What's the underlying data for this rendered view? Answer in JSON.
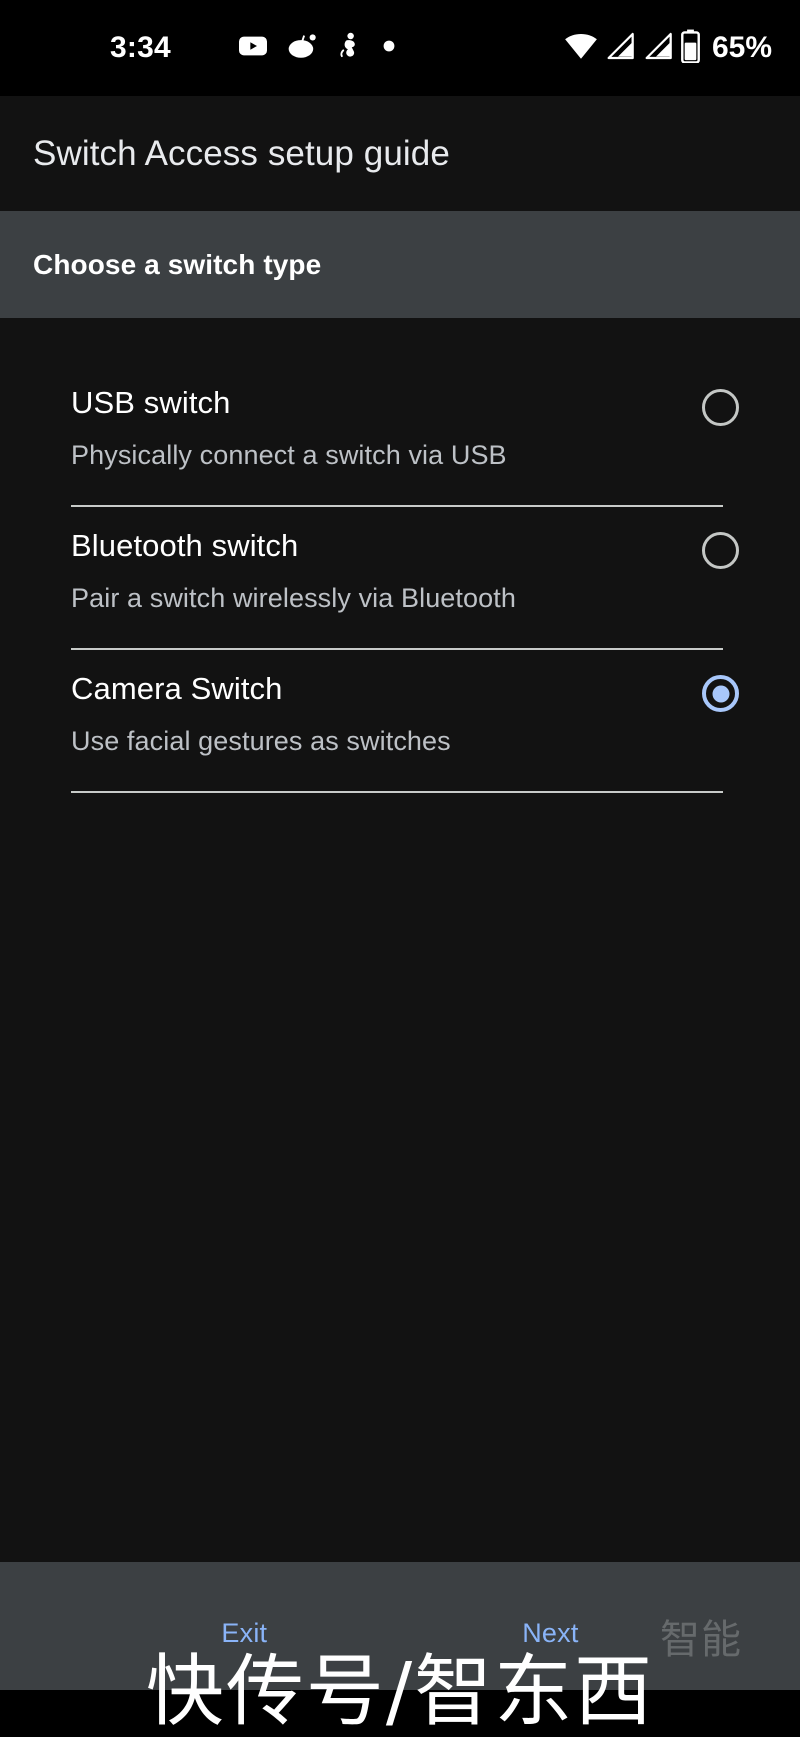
{
  "status_bar": {
    "time": "3:34",
    "battery_percent": "65%",
    "left_icons": [
      {
        "name": "telegram-icon"
      },
      {
        "name": "youtube-icon"
      },
      {
        "name": "reddit-icon"
      },
      {
        "name": "app-notification-icon"
      },
      {
        "name": "dot-notification-icon"
      }
    ],
    "right_icons": [
      {
        "name": "wifi-icon"
      },
      {
        "name": "cellular-signal-1-icon"
      },
      {
        "name": "cellular-signal-2-icon"
      },
      {
        "name": "battery-icon"
      }
    ]
  },
  "header": {
    "title": "Switch Access setup guide"
  },
  "section": {
    "heading": "Choose a switch type"
  },
  "options": [
    {
      "title": "USB switch",
      "description": "Physically connect a switch via USB",
      "selected": false
    },
    {
      "title": "Bluetooth switch",
      "description": "Pair a switch wirelessly via Bluetooth",
      "selected": false
    },
    {
      "title": "Camera Switch",
      "description": "Use facial gestures as switches",
      "selected": true
    }
  ],
  "bottom_bar": {
    "exit_label": "Exit",
    "next_label": "Next"
  },
  "watermark": {
    "text": "快传号/智东西",
    "sub_text": "智能"
  },
  "colors": {
    "background": "#121212",
    "band": "#3c4043",
    "accent": "#a8c7fa",
    "link": "#8ab4f8",
    "primary_text": "#ffffff",
    "secondary_text": "#bdc1c6",
    "divider": "#c8cbc9"
  }
}
